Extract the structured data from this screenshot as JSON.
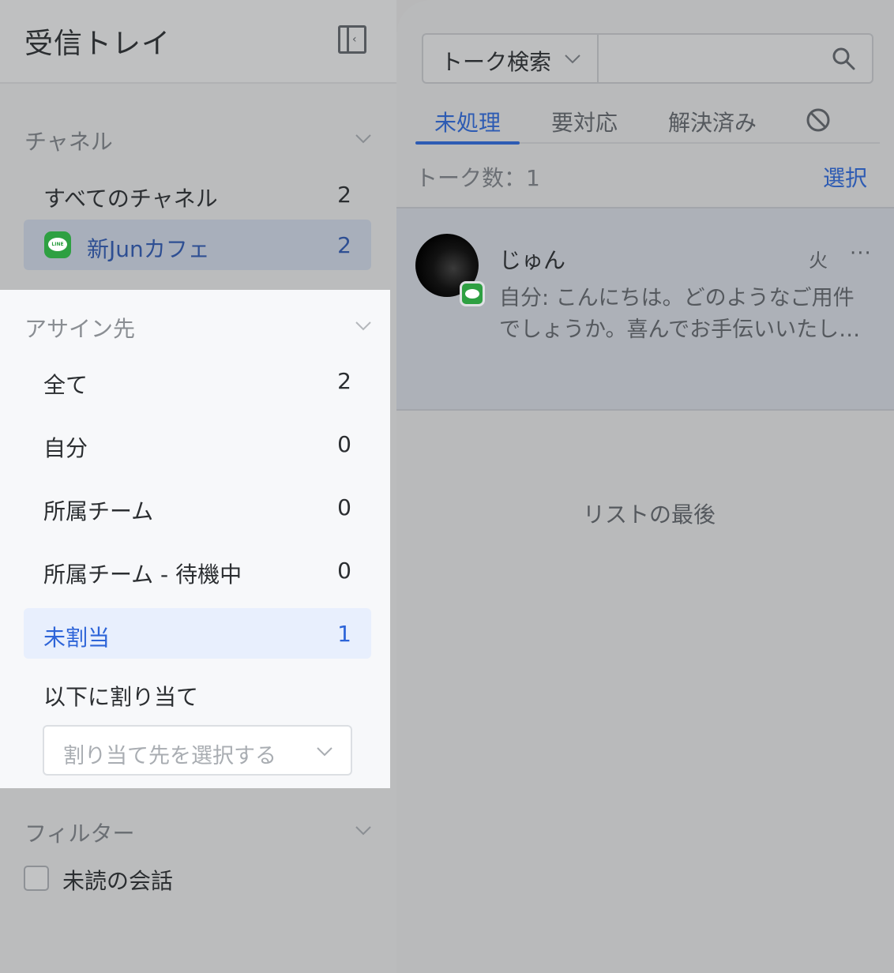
{
  "sidebar": {
    "title": "受信トレイ",
    "channel_section": {
      "title": "チャネル",
      "items": [
        {
          "label": "すべてのチャネル",
          "count": "2"
        },
        {
          "label": "新Junカフェ",
          "count": "2",
          "icon": "line-icon"
        }
      ]
    },
    "assign_section": {
      "title": "アサイン先",
      "items": [
        {
          "label": "全て",
          "count": "2"
        },
        {
          "label": "自分",
          "count": "0"
        },
        {
          "label": "所属チーム",
          "count": "0"
        },
        {
          "label": "所属チーム - 待機中",
          "count": "0"
        },
        {
          "label": "未割当",
          "count": "1"
        }
      ],
      "assign_to_label": "以下に割り当て",
      "assign_select_placeholder": "割り当て先を選択する"
    },
    "filter_section": {
      "title": "フィルター",
      "unread_label": "未読の会話"
    }
  },
  "main": {
    "search_type": "トーク検索",
    "search_value": "",
    "tabs": [
      "未処理",
      "要対応",
      "解決済み"
    ],
    "active_tab": "未処理",
    "talk_count": "トーク数：1",
    "select_label": "選択",
    "talks": [
      {
        "name": "じゅん",
        "day": "火",
        "more": "···",
        "preview": "自分: こんにちは。どのようなご用件でしょうか。喜んでお手伝いいたし…"
      }
    ],
    "list_end": "リストの最後"
  },
  "colors": {
    "accent": "#2d64d8",
    "line_green": "#2ea042",
    "selected_bg": "#e8effd"
  }
}
